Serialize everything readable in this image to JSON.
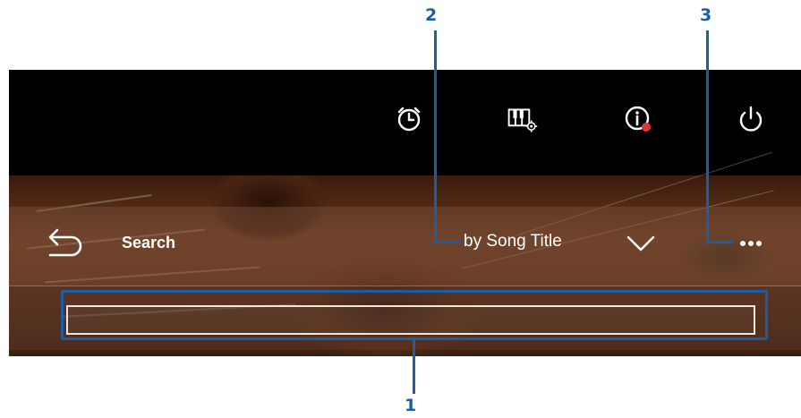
{
  "callouts": {
    "one": "1",
    "two": "2",
    "three": "3"
  },
  "topbar": {
    "icons": [
      "alarm-clock-icon",
      "keyboard-settings-icon",
      "info-icon",
      "power-icon"
    ]
  },
  "header": {
    "title": "Search",
    "sort_label": "by Song Title"
  },
  "search": {
    "value": "",
    "placeholder": ""
  },
  "colors": {
    "callout": "#1a5ea8",
    "notification_dot": "#e0353b"
  }
}
